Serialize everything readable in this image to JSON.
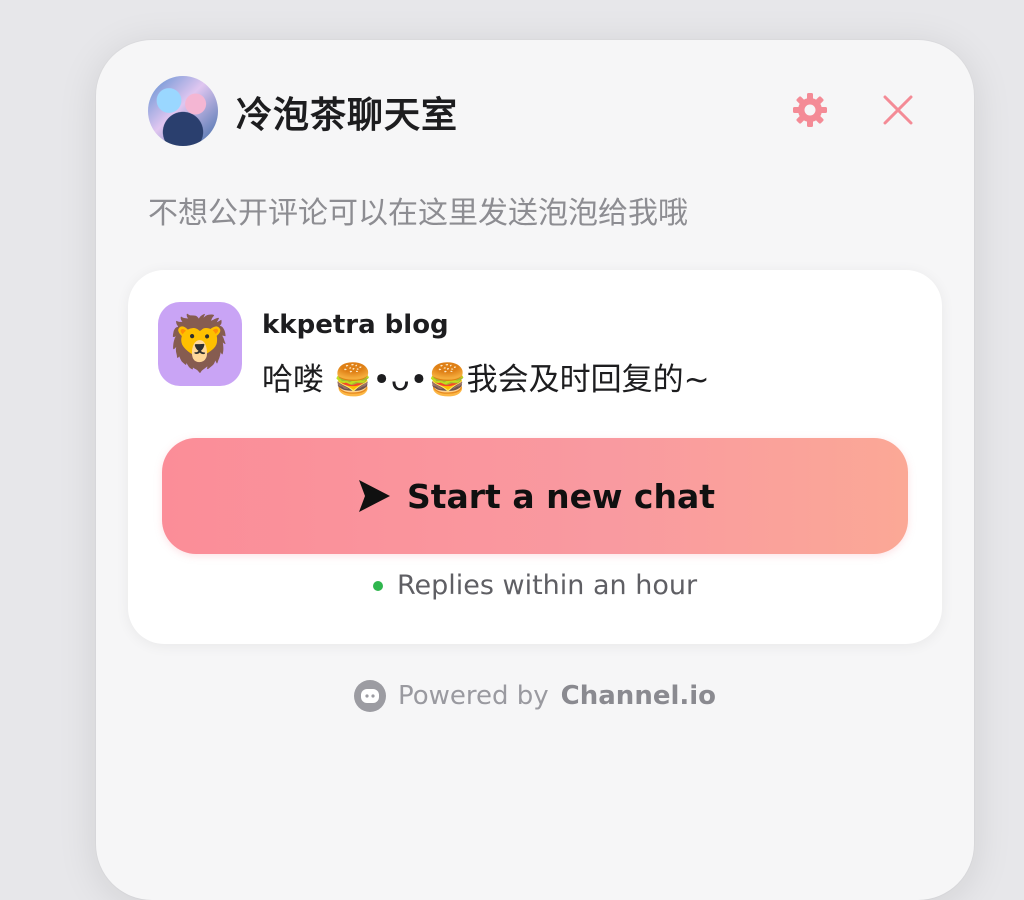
{
  "header": {
    "title": "冷泡茶聊天室",
    "avatar_icon": "profile-avatar",
    "settings_icon": "gear-icon",
    "close_icon": "close-icon",
    "accent_color": "#f48b96"
  },
  "subtitle": "不想公开评论可以在这里发送泡泡给我哦",
  "card": {
    "bot_name": "kkpetra blog",
    "bot_avatar_emoji": "🦁",
    "bot_message": "哈喽 🍔•ᴗ•🍔我会及时回复的~",
    "start_button_label": "Start a new chat",
    "start_button_icon": "send-arrow-icon",
    "status_text": "Replies within an hour",
    "status_color": "#2fb64e"
  },
  "footer": {
    "powered_by": "Powered by",
    "brand": "Channel.io",
    "icon": "channel-io-icon"
  }
}
